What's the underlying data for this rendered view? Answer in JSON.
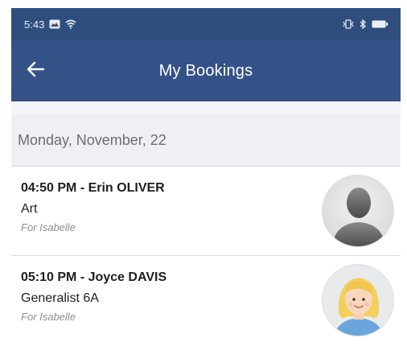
{
  "status_bar": {
    "time": "5:43",
    "left_icons": [
      "image-icon",
      "wifi-icon"
    ],
    "right_icons": [
      "vibrate-icon",
      "bluetooth-icon",
      "battery-icon"
    ]
  },
  "app_bar": {
    "title": "My Bookings",
    "back_icon": "back-arrow-icon"
  },
  "section": {
    "date_header": "Monday, November, 22"
  },
  "bookings": [
    {
      "time_teacher": "04:50 PM - Erin OLIVER",
      "subject": "Art",
      "for_label": "For Isabelle",
      "avatar": "default-person-avatar"
    },
    {
      "time_teacher": "05:10 PM - Joyce DAVIS",
      "subject": "Generalist 6A",
      "for_label": "For Isabelle",
      "avatar": "blonde-woman-avatar"
    }
  ],
  "colors": {
    "status_bar": "#2f4e7e",
    "app_bar": "#345287",
    "section_bg": "#eef0f4"
  }
}
